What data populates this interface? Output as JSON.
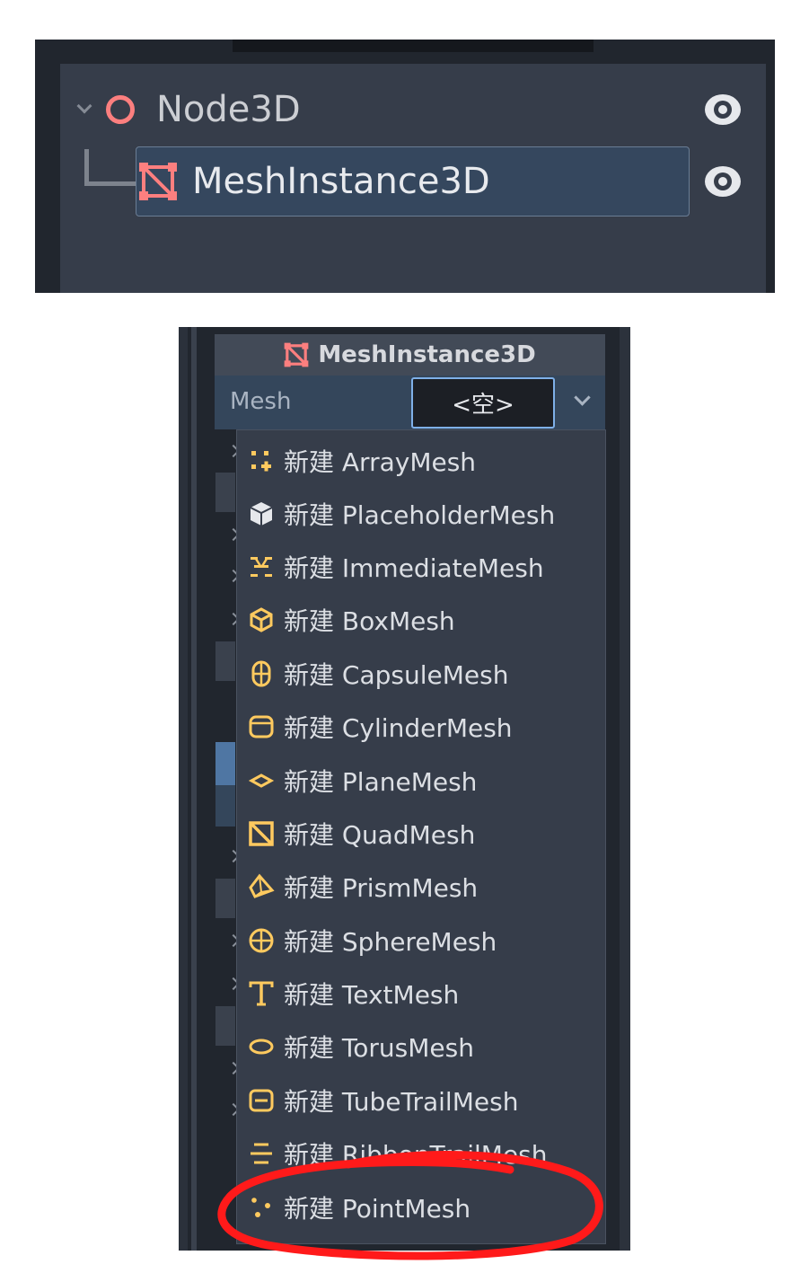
{
  "scene_tree": {
    "root": {
      "label": "Node3D",
      "icon": "node3d-circle-icon"
    },
    "child": {
      "label": "MeshInstance3D",
      "icon": "meshinstance3d-icon"
    },
    "visibility_icon": "eye-icon"
  },
  "inspector": {
    "title": "MeshInstance3D",
    "property": {
      "label": "Mesh",
      "value": "<空>"
    }
  },
  "menu": {
    "items": [
      {
        "label": "新建 ArrayMesh",
        "icon": "arraymesh-icon"
      },
      {
        "label": "新建 PlaceholderMesh",
        "icon": "placeholdermesh-icon"
      },
      {
        "label": "新建 ImmediateMesh",
        "icon": "immediatemesh-icon"
      },
      {
        "label": "新建 BoxMesh",
        "icon": "boxmesh-icon"
      },
      {
        "label": "新建 CapsuleMesh",
        "icon": "capsulemesh-icon"
      },
      {
        "label": "新建 CylinderMesh",
        "icon": "cylindermesh-icon"
      },
      {
        "label": "新建 PlaneMesh",
        "icon": "planemesh-icon"
      },
      {
        "label": "新建 QuadMesh",
        "icon": "quadmesh-icon"
      },
      {
        "label": "新建 PrismMesh",
        "icon": "prismmesh-icon"
      },
      {
        "label": "新建 SphereMesh",
        "icon": "spheremesh-icon"
      },
      {
        "label": "新建 TextMesh",
        "icon": "textmesh-icon"
      },
      {
        "label": "新建 TorusMesh",
        "icon": "torusmesh-icon"
      },
      {
        "label": "新建 TubeTrailMesh",
        "icon": "tubetrailmesh-icon"
      },
      {
        "label": "新建 RibbonTrailMesh",
        "icon": "ribbontrailmesh-icon"
      },
      {
        "label": "新建 PointMesh",
        "icon": "pointmesh-icon"
      }
    ]
  },
  "annotation": {
    "highlighted_item": "新建 PointMesh"
  },
  "colors": {
    "node_red": "#fc7f7f",
    "mesh_yellow": "#ffca5f",
    "selection": "#35475e",
    "annotation_red": "#ff1a1a"
  }
}
